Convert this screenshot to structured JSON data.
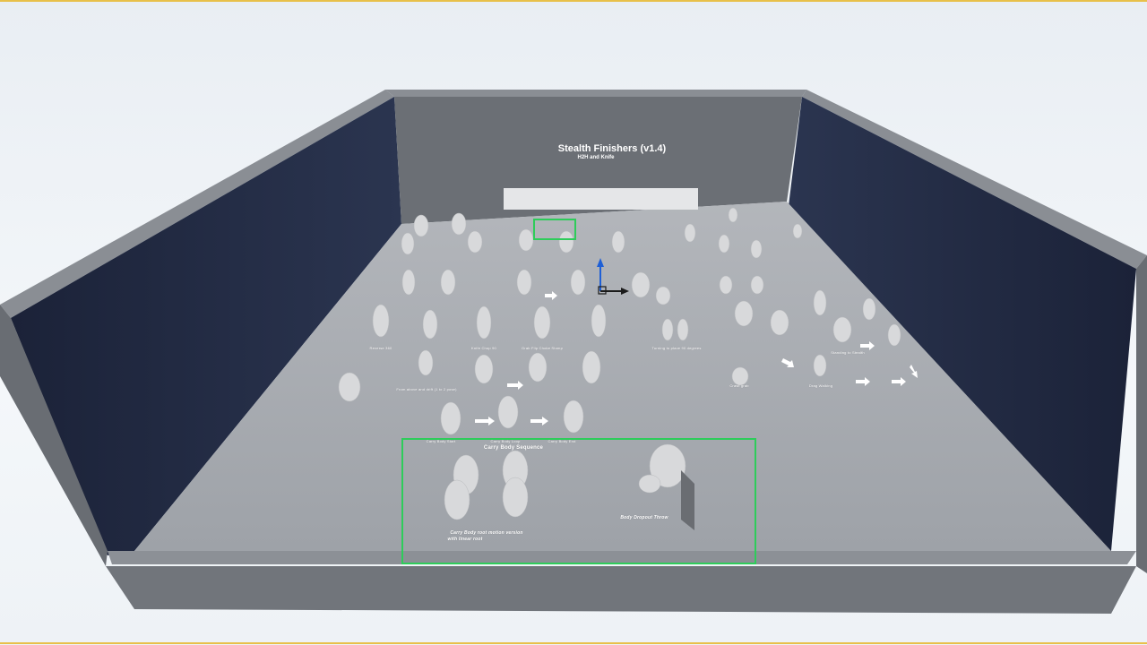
{
  "scene": {
    "title": "Stealth Finishers (v1.4)",
    "subtitle": "H2H and Knife"
  },
  "labels": {
    "carry_body_sequence": "Carry Body Sequence",
    "carry_body_root_motion_1": "Carry Body root motion version",
    "carry_body_root_motion_2": "with linear root",
    "body_dropout_throw": "Body Dropout Throw",
    "carry_body_start": "Carry Body Start",
    "carry_body_loop": "Carry Body Loop",
    "carry_body_end": "Carry Body End",
    "reverse_360": "Reverse 360",
    "knife_chop": "Knife Chop 90",
    "grab_flip_choke": "Grab Flip Choke Stomp",
    "turning_to_place": "Turning to place 90 degrees",
    "stand_to_stealth": "Standing to Stealth",
    "drag_walking": "Drag Walking",
    "crawl_grab": "Crawl grab",
    "from_above": "From above and drift (1 to 2 pose)"
  },
  "colors": {
    "selection": "#2ecc5a",
    "wall": "#1f2740",
    "floor": "#8f9399",
    "rim": "#7c8086",
    "top_edge": "#e8c04a"
  }
}
